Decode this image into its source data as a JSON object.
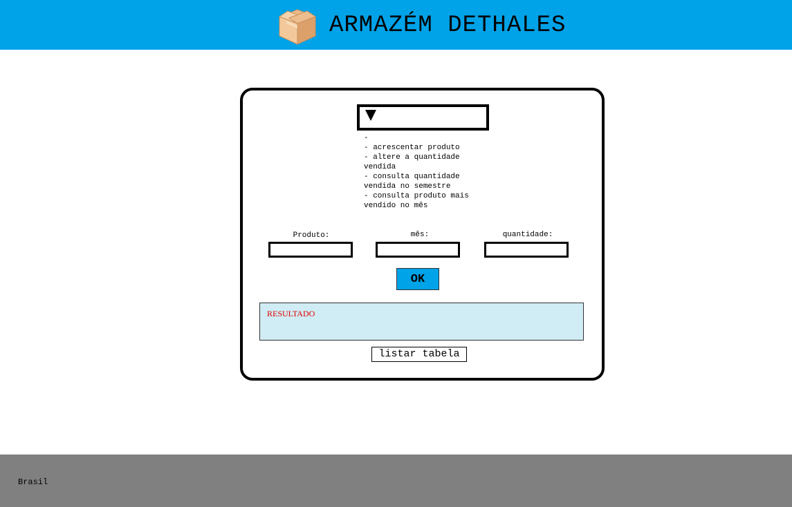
{
  "header": {
    "title": "ARMAZÉM DETHALES",
    "logo_icon": "cardboard-box-icon",
    "background_color": "#00a2e8"
  },
  "form": {
    "select": {
      "selected": "",
      "arrow_icon": "triangle-down-icon",
      "options": [
        "-",
        "- acrescentar produto",
        "- altere a quantidade vendida",
        "- consulta quantidade vendida no semestre",
        "- consulta produto mais vendido no mês"
      ]
    },
    "fields": {
      "produto_label": "Produto:",
      "mes_label": "mês:",
      "quantidade_label": "quantidade:",
      "produto_value": "",
      "mes_value": "",
      "quantidade_value": ""
    },
    "ok_label": "OK",
    "ok_color": "#00a2e8",
    "result_label": "RESULTADO",
    "result_color": "#e00000",
    "result_background": "#d0ecf4",
    "list_button_label": "listar tabela"
  },
  "footer": {
    "text": "Brasil",
    "background_color": "#808080"
  }
}
